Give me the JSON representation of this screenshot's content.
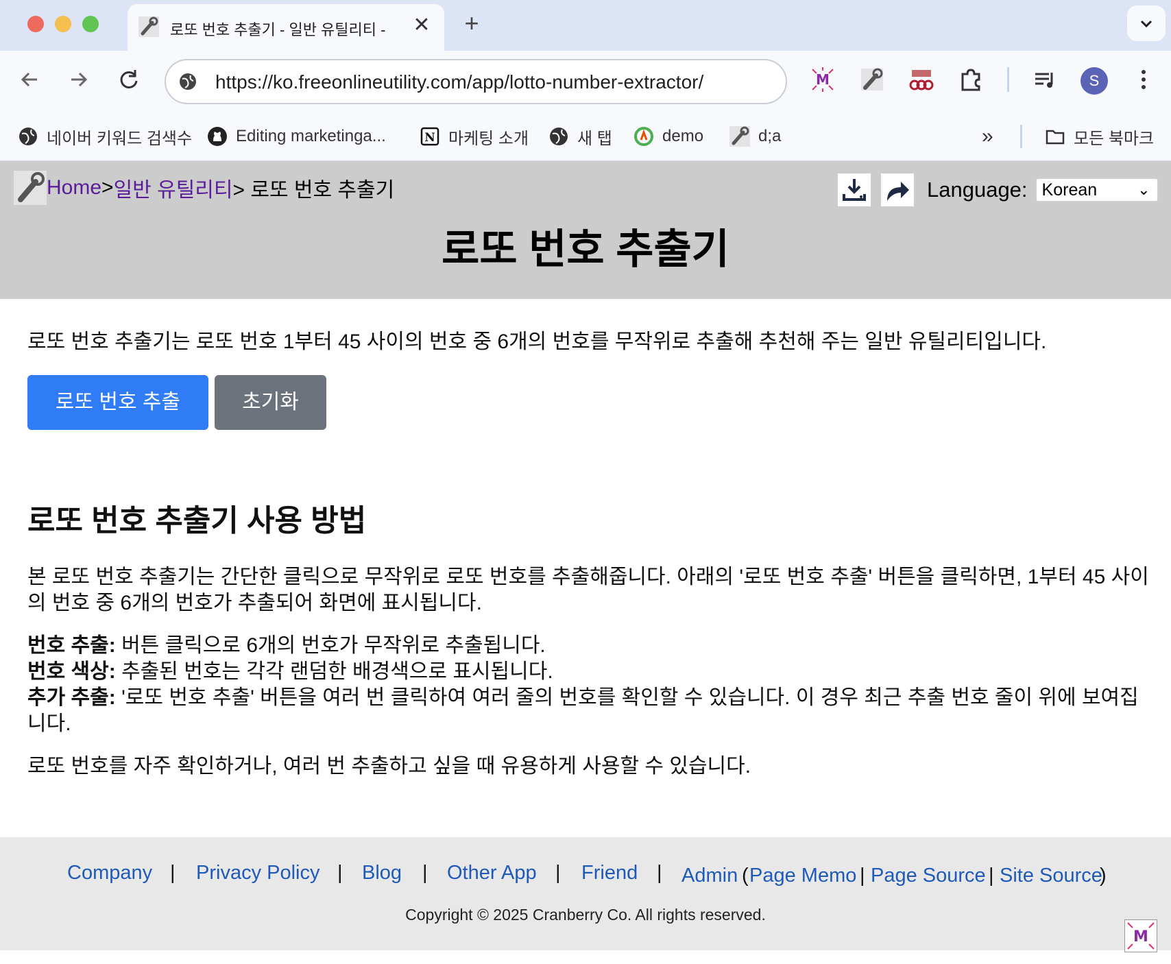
{
  "browser": {
    "tab_title": "로또 번호 추출기 - 일반 유틸리티 -",
    "tab_close": "✕",
    "new_tab": "+",
    "url": "https://ko.freeonlineutility.com/app/lotto-number-extractor/",
    "profile_initial": "S",
    "bookmarks": [
      {
        "label": "네이버 키워드 검색수",
        "icon": "globe-icon"
      },
      {
        "label": "Editing marketinga...",
        "icon": "github-icon"
      },
      {
        "label": "마케팅 소개",
        "icon": "notion-icon"
      },
      {
        "label": "새 탭",
        "icon": "globe-icon"
      },
      {
        "label": "demo",
        "icon": "demo-icon"
      },
      {
        "label": "d;a",
        "icon": "wrench-icon"
      }
    ],
    "more_bookmarks": "»",
    "all_bookmarks": "모든 북마크"
  },
  "header": {
    "crumb_home": "Home",
    "crumb_sep1": ">",
    "crumb_category": "일반 유틸리티",
    "crumb_current": "> 로또 번호 추출기",
    "language_label": "Language:",
    "language_value": "Korean",
    "title": "로또 번호 추출기"
  },
  "main": {
    "intro": "로또 번호 추출기는 로또 번호 1부터 45 사이의 번호 중 6개의 번호를 무작위로 추출해 추천해 주는 일반 유틸리티입니다.",
    "extract_button": "로또 번호 추출",
    "reset_button": "초기화",
    "howto_title": "로또 번호 추출기 사용 방법",
    "howto_p1": "본 로또 번호 추출기는 간단한 클릭으로 무작위로 로또 번호를 추출해줍니다. 아래의 '로또 번호 추출' 버튼을 클릭하면, 1부터 45 사이의 번호 중 6개의 번호가 추출되어 화면에 표시됩니다.",
    "features": [
      {
        "label": "번호 추출:",
        "text": " 버튼 클릭으로 6개의 번호가 무작위로 추출됩니다."
      },
      {
        "label": "번호 색상:",
        "text": " 추출된 번호는 각각 랜덤한 배경색으로 표시됩니다."
      },
      {
        "label": "추가 추출:",
        "text": " '로또 번호 추출' 버튼을 여러 번 클릭하여 여러 줄의 번호를 확인할 수 있습니다. 이 경우 최근 추출 번호 줄이 위에 보여집니다."
      }
    ],
    "howto_p3": "로또 번호를 자주 확인하거나, 여러 번 추출하고 싶을 때 유용하게 사용할 수 있습니다."
  },
  "footer": {
    "company": "Company",
    "privacy": "Privacy Policy",
    "blog": "Blog",
    "other_app": "Other App",
    "friend": "Friend",
    "admin": "Admin",
    "page_memo": "Page Memo",
    "page_source": "Page Source",
    "site_source": "Site Source",
    "pipe": "|",
    "open_paren": "(",
    "close_paren": ")",
    "copyright": "Copyright © 2025 Cranberry Co. All rights reserved."
  },
  "colors": {
    "primary_button": "#2f7cf6",
    "secondary_button": "#6c737c",
    "header_bg": "#cccccc",
    "link": "#1f5ab8",
    "crumb_link": "#5a1d9a"
  }
}
